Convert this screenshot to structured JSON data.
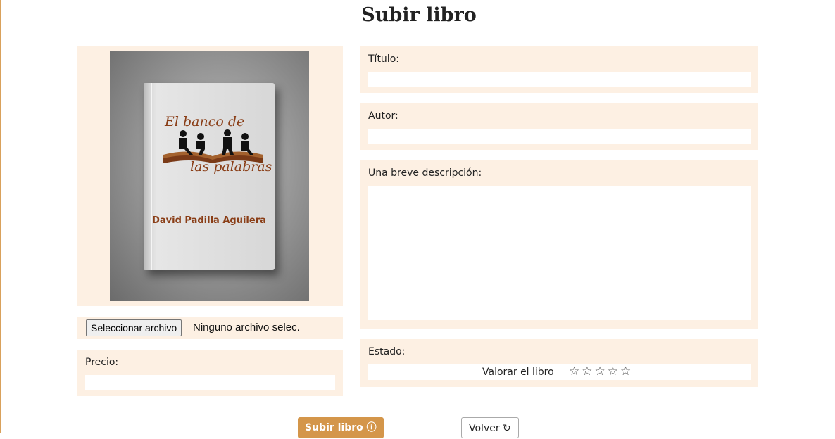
{
  "page": {
    "title": "Subir libro"
  },
  "cover": {
    "book_title_line1": "El banco de",
    "book_title_line2": "las palabras",
    "book_author": "David Padilla Aguilera"
  },
  "file": {
    "button_label": "Seleccionar archivo",
    "status": "Ninguno archivo selec."
  },
  "form": {
    "precio_label": "Precio:",
    "titulo_label": "Título:",
    "autor_label": "Autor:",
    "descripcion_label": "Una breve descripción:",
    "estado_label": "Estado:",
    "rating_label": "Valorar el libro",
    "stars": "☆☆☆☆☆"
  },
  "buttons": {
    "upload": "Subir libro ⓘ",
    "back": "Volver ↻"
  },
  "colors": {
    "accent": "#d4964a",
    "panel": "#fdf0e3"
  }
}
